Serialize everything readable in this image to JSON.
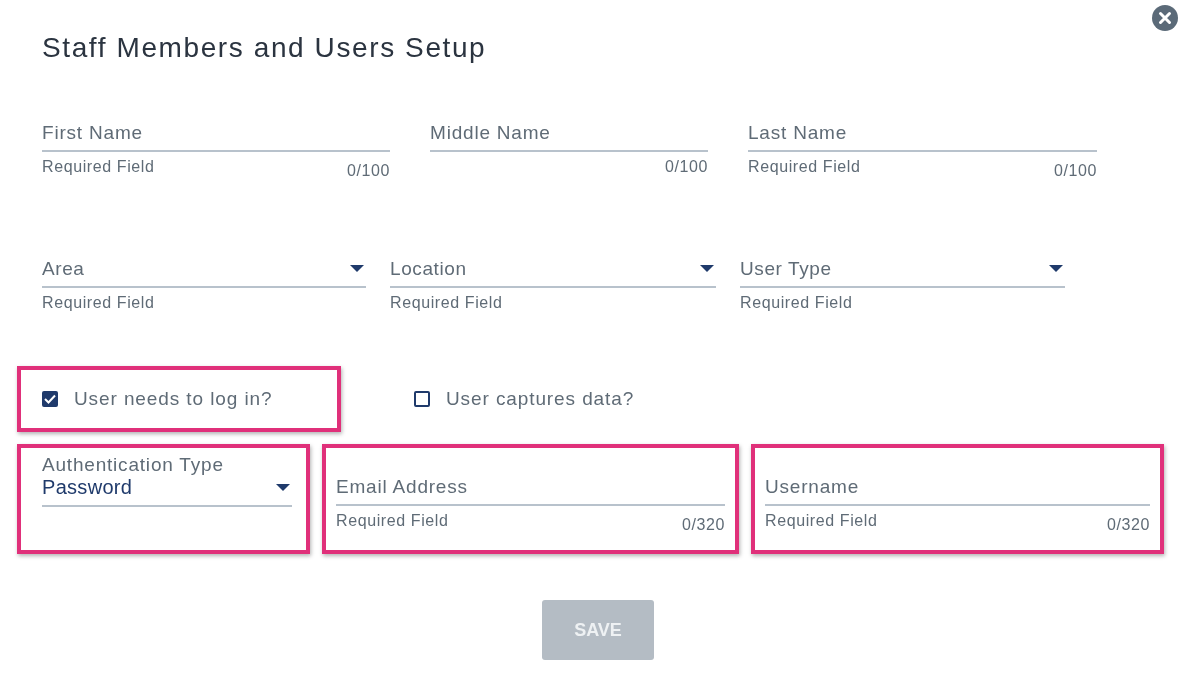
{
  "dialog": {
    "title": "Staff Members and Users Setup"
  },
  "rows": [
    {
      "fields": [
        {
          "kind": "text",
          "placeholder": "First Name",
          "helper": "Required Field",
          "counter": "0/100",
          "highlighted": false
        },
        {
          "kind": "text",
          "placeholder": "Middle Name",
          "counter": "0/100",
          "highlighted": false
        },
        {
          "kind": "text",
          "placeholder": "Last Name",
          "helper": "Required Field",
          "counter": "0/100",
          "highlighted": false
        }
      ]
    },
    {
      "fields": [
        {
          "kind": "select",
          "placeholder": "Area",
          "helper": "Required Field",
          "highlighted": false
        },
        {
          "kind": "select",
          "placeholder": "Location",
          "helper": "Required Field",
          "highlighted": false
        },
        {
          "kind": "select",
          "placeholder": "User Type",
          "helper": "Required Field",
          "highlighted": false
        }
      ]
    }
  ],
  "checkboxes": [
    {
      "label": "User needs to log in?",
      "checked": true,
      "highlighted": true
    },
    {
      "label": "User captures data?",
      "checked": false,
      "highlighted": false
    }
  ],
  "login_fields": [
    {
      "kind": "select",
      "label": "Authentication Type",
      "value": "Password",
      "highlighted": true
    },
    {
      "kind": "text",
      "placeholder": "Email Address",
      "helper": "Required Field",
      "counter": "0/320",
      "highlighted": true
    },
    {
      "kind": "text",
      "placeholder": "Username",
      "helper": "Required Field",
      "counter": "0/320",
      "highlighted": true
    }
  ],
  "save_button": {
    "label": "SAVE",
    "disabled": true
  }
}
